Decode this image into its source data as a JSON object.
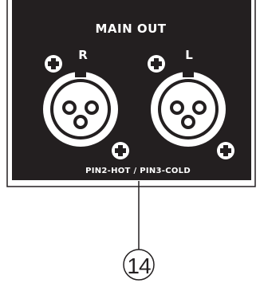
{
  "panel": {
    "title": "MAIN OUT",
    "pin_label": "PIN2-HOT / PIN3-COLD",
    "background_color": "#231f20",
    "foreground_color": "#ffffff"
  },
  "connectors": [
    {
      "label": "R",
      "type": "xlr-female-3-pin"
    },
    {
      "label": "L",
      "type": "xlr-female-3-pin"
    }
  ],
  "callout": {
    "number": "14"
  }
}
